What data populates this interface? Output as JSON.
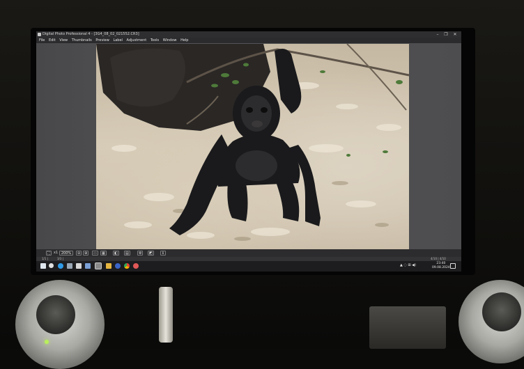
{
  "window": {
    "title": "Digital Photo Professional 4 - [3G4_08_02_021552.CR3]",
    "controls": [
      "minimize-icon",
      "restore-icon",
      "close-icon"
    ]
  },
  "menu": [
    "File",
    "Edit",
    "View",
    "Thumbnails",
    "Preview",
    "Label",
    "Adjustment",
    "Tools",
    "Window",
    "Help"
  ],
  "toolbar": {
    "zoom_prefix": "x1",
    "zoom_value": "200%",
    "icons": [
      "fit-icon",
      "zoom-out-icon",
      "zoom-in-icon",
      "crop-icon",
      "grid-icon",
      "compare-icon",
      "display-icon",
      "settings-icon",
      "info-icon"
    ]
  },
  "statusbar": {
    "left": "1/1 |",
    "middle": "3/3 |",
    "right": "4/10 | 4/10"
  },
  "taskbar": {
    "apps": [
      "windows-icon",
      "search-icon",
      "edge-icon",
      "explorer-icon",
      "app-icon",
      "canon-icon",
      "folder-icon",
      "chrome-icon",
      "photo-icon"
    ],
    "time": "23:40",
    "date": "09.08.2024"
  }
}
